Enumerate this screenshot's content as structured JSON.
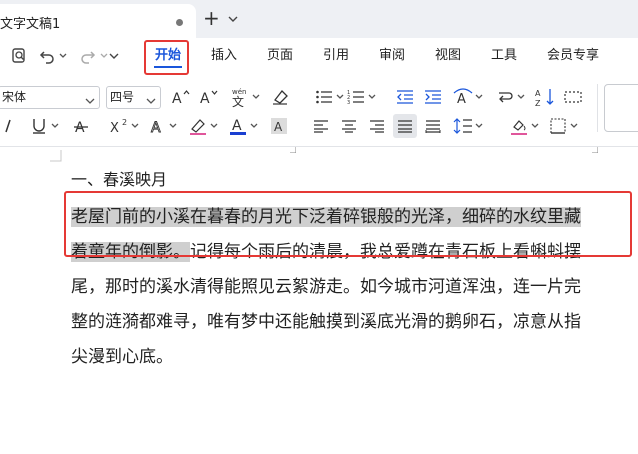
{
  "window": {
    "doc_tab_title": "文字文稿1"
  },
  "ribbon": {
    "menu_tabs": [
      {
        "label": "开始",
        "active": true
      },
      {
        "label": "插入"
      },
      {
        "label": "页面"
      },
      {
        "label": "引用"
      },
      {
        "label": "审阅"
      },
      {
        "label": "视图"
      },
      {
        "label": "工具"
      },
      {
        "label": "会员专享"
      }
    ],
    "font_name": "宋体",
    "font_size": "四号",
    "accent_color": "#1a56db",
    "font_color": "#1a3fd1",
    "highlight_box_color": "#e53935",
    "icons": [
      "preview-icon",
      "undo-icon",
      "redo-icon",
      "more-icon",
      "grow-font-icon",
      "shrink-font-icon",
      "pinyin-icon",
      "clear-format-icon",
      "bullet-list-icon",
      "numbered-list-icon",
      "decrease-indent-icon",
      "increase-indent-icon",
      "text-direction-icon",
      "sort-icon",
      "italic-icon",
      "underline-icon",
      "strikethrough-icon",
      "superscript-icon",
      "text-effect-icon",
      "highlight-icon",
      "font-color-icon",
      "char-shading-icon",
      "align-left-icon",
      "align-center-icon",
      "align-right-icon",
      "justify-icon",
      "distributed-icon",
      "line-spacing-icon",
      "shading-icon",
      "border-icon"
    ]
  },
  "document": {
    "heading": "一、春溪映月",
    "lines": [
      {
        "highlighted": "老屋门前的小溪在暮春的月光下泛着碎银般的光泽，细碎的水纹里藏",
        "rest": ""
      },
      {
        "highlighted": "着童年的倒影。",
        "rest": "记得每个雨后的清晨，我总爱蹲在青石板上看蝌蚪摆"
      },
      {
        "highlighted": "",
        "rest": "尾，那时的溪水清得能照见云絮游走。如今城市河道浑浊，连一片完"
      },
      {
        "highlighted": "",
        "rest": "整的涟漪都难寻，唯有梦中还能触摸到溪底光滑的鹅卵石，凉意从指"
      },
      {
        "highlighted": "",
        "rest": "尖漫到心底。"
      }
    ]
  }
}
